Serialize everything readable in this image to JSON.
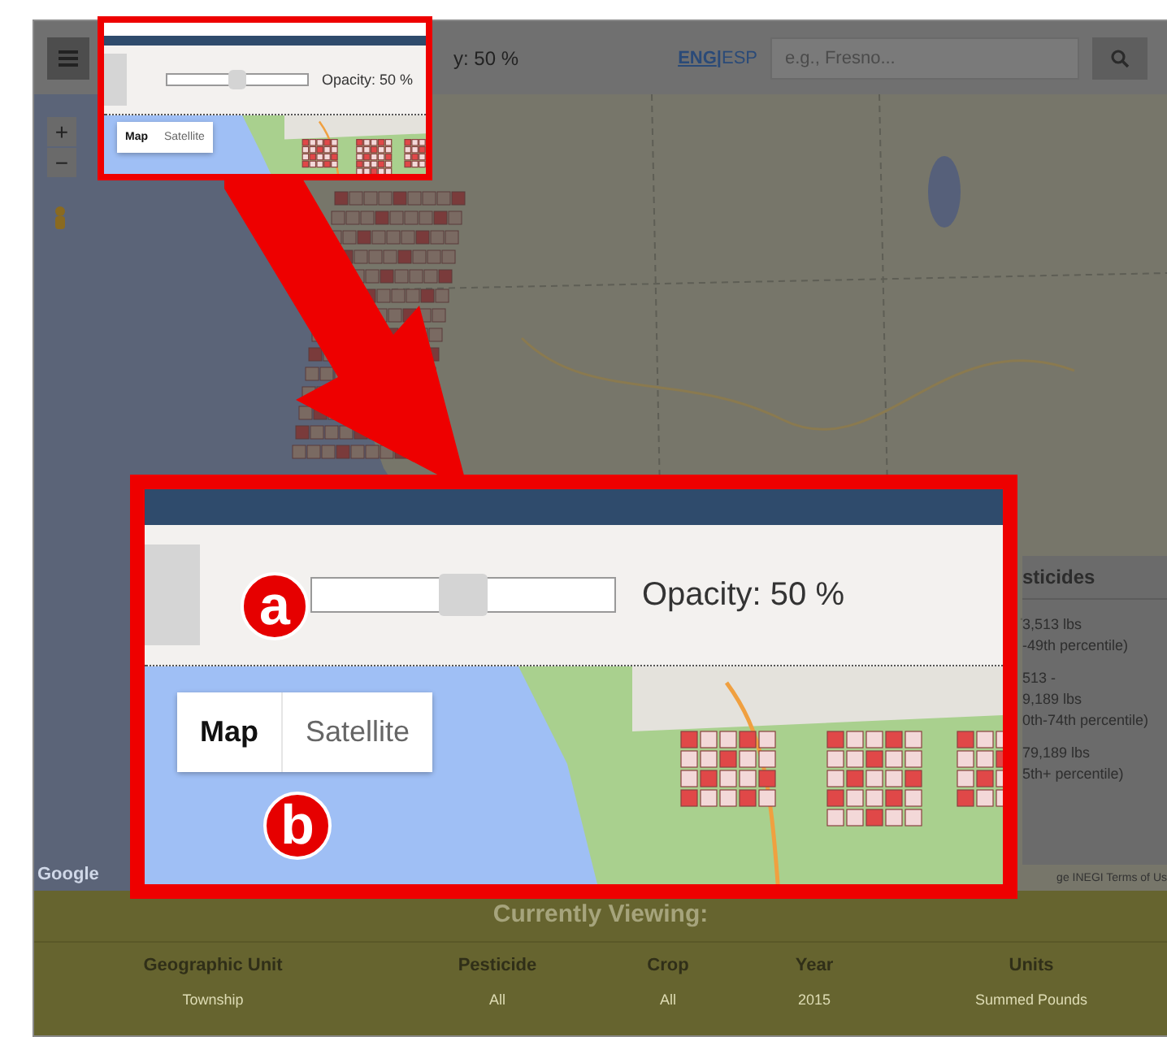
{
  "toolbar": {
    "opacity_label": "y: 50 %",
    "languages": [
      {
        "label": "ENG",
        "selected": true
      },
      {
        "label": "ESP",
        "selected": false
      }
    ],
    "language_separator": "|",
    "search": {
      "placeholder": "e.g., Fresno..."
    }
  },
  "map_controls": {
    "zoom_in": "+",
    "zoom_out": "−"
  },
  "legend": {
    "title": "sticides",
    "entries": [
      {
        "lines": [
          "3,513  lbs",
          "-49th percentile)"
        ]
      },
      {
        "lines": [
          "513  -",
          "9,189  lbs",
          "0th-74th percentile)"
        ]
      },
      {
        "lines": [
          "79,189  lbs",
          "5th+ percentile)"
        ]
      }
    ]
  },
  "map_attribution": {
    "logo": "Google",
    "terms": "ge  INEGI   Terms of Us"
  },
  "currently_viewing": {
    "title": "Currently Viewing:",
    "columns": [
      "Geographic Unit",
      "Pesticide",
      "Crop",
      "Year",
      "Units"
    ],
    "rows": [
      [
        "Township",
        "All",
        "All",
        "2015",
        "Summed Pounds"
      ]
    ]
  },
  "callouts": [
    {
      "opacity": {
        "level": 0.5,
        "label": "Opacity: 50 %"
      },
      "map_types": [
        {
          "label": "Map",
          "selected": true
        },
        {
          "label": "Satellite",
          "selected": false
        }
      ]
    },
    {
      "opacity": {
        "level": 0.5,
        "label": "Opacity: 50 %"
      },
      "map_types": [
        {
          "label": "Map",
          "selected": true
        },
        {
          "label": "Satellite",
          "selected": false
        }
      ],
      "markers": [
        {
          "label": "a"
        },
        {
          "label": "b"
        }
      ]
    }
  ]
}
